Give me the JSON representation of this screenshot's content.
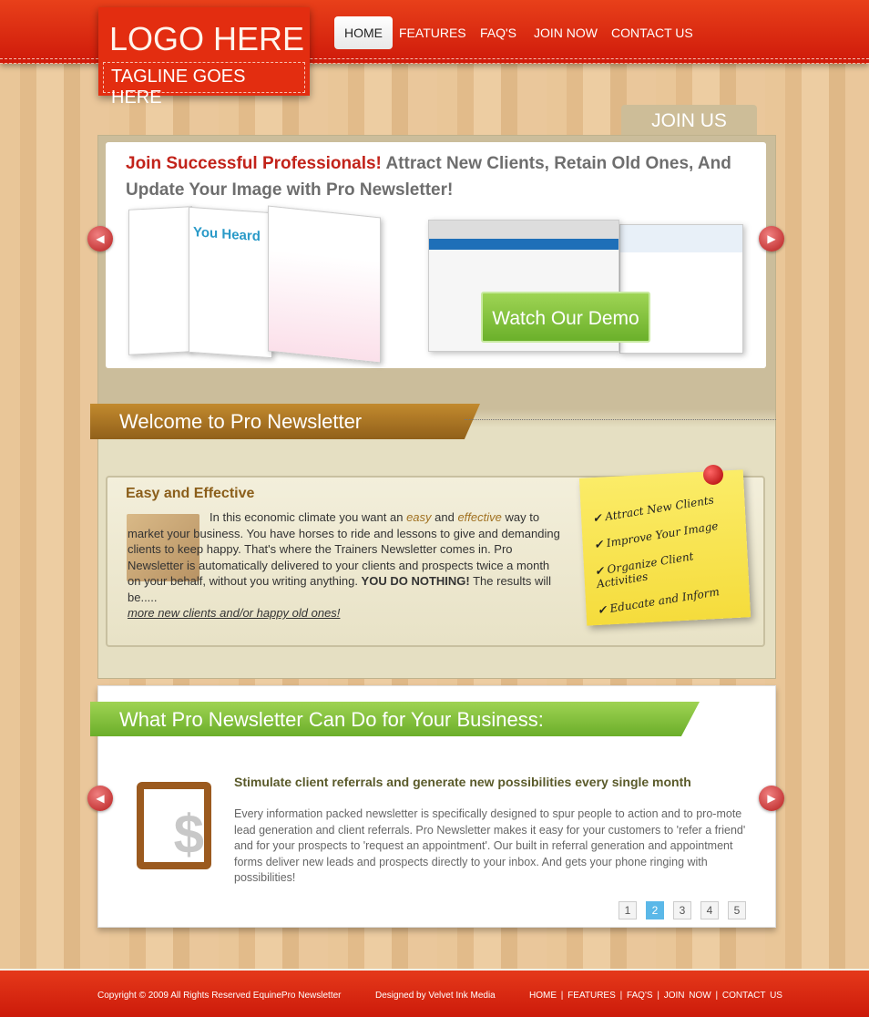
{
  "header": {
    "logo": "LOGO HERE",
    "tagline": "TAGLINE GOES HERE",
    "nav": [
      "HOME",
      "FEATURES",
      "FAQ'S",
      "JOIN NOW",
      "CONTACT US"
    ]
  },
  "slider": {
    "tab": "JOIN US",
    "headline_red": "Join Successful Professionals!",
    "headline_rest": " Attract New Clients, Retain Old Ones,  And Update Your Image with Pro Newsletter!",
    "card_title": "You Heard",
    "demo_button": "Watch Our Demo"
  },
  "welcome": {
    "title": "Welcome to Pro Newsletter",
    "heading": "Easy and Effective",
    "p1": "In this economic climate you want an ",
    "easy": "easy",
    "p2": " and ",
    "effective": "effective",
    "p3": " way to market your business. You have horses to ride and lessons to give and demanding clients to keep happy. That's where the Trainers Newsletter comes in.  Pro Newsletter is automatically delivered to your clients and prospects twice a month on your behalf, without you writing anything. ",
    "bold": "YOU DO NOTHING!",
    "p4": " The results will be.....",
    "link": "more new clients and/or happy old ones!",
    "note": [
      "Attract New Clients",
      "Improve Your Image",
      "Organize Client Activities",
      "Educate and Inform"
    ]
  },
  "features": {
    "title": "What Pro Newsletter Can Do for Your Business:",
    "subtitle": "Stimulate client referrals and generate new possibilities every single month",
    "text": "Every information packed newsletter is specifically designed to spur people to action and to pro-mote lead generation and client referrals. Pro Newsletter makes it easy for your customers to 'refer a friend' and for your prospects to 'request an appointment'. Our built in referral generation and appointment forms deliver new leads and prospects directly to your inbox.  And gets your phone ringing with possibilities!",
    "pages": [
      "1",
      "2",
      "3",
      "4",
      "5"
    ],
    "active_page": "2"
  },
  "footer": {
    "copyright": "Copyright © 2009 All Rights Reserved EquinePro Newsletter",
    "designed": "Designed by Velvet Ink Media",
    "links": [
      "HOME",
      "FEATURES",
      "FAQ'S",
      "JOIN NOW",
      "CONTACT US"
    ],
    "separator": "|"
  }
}
